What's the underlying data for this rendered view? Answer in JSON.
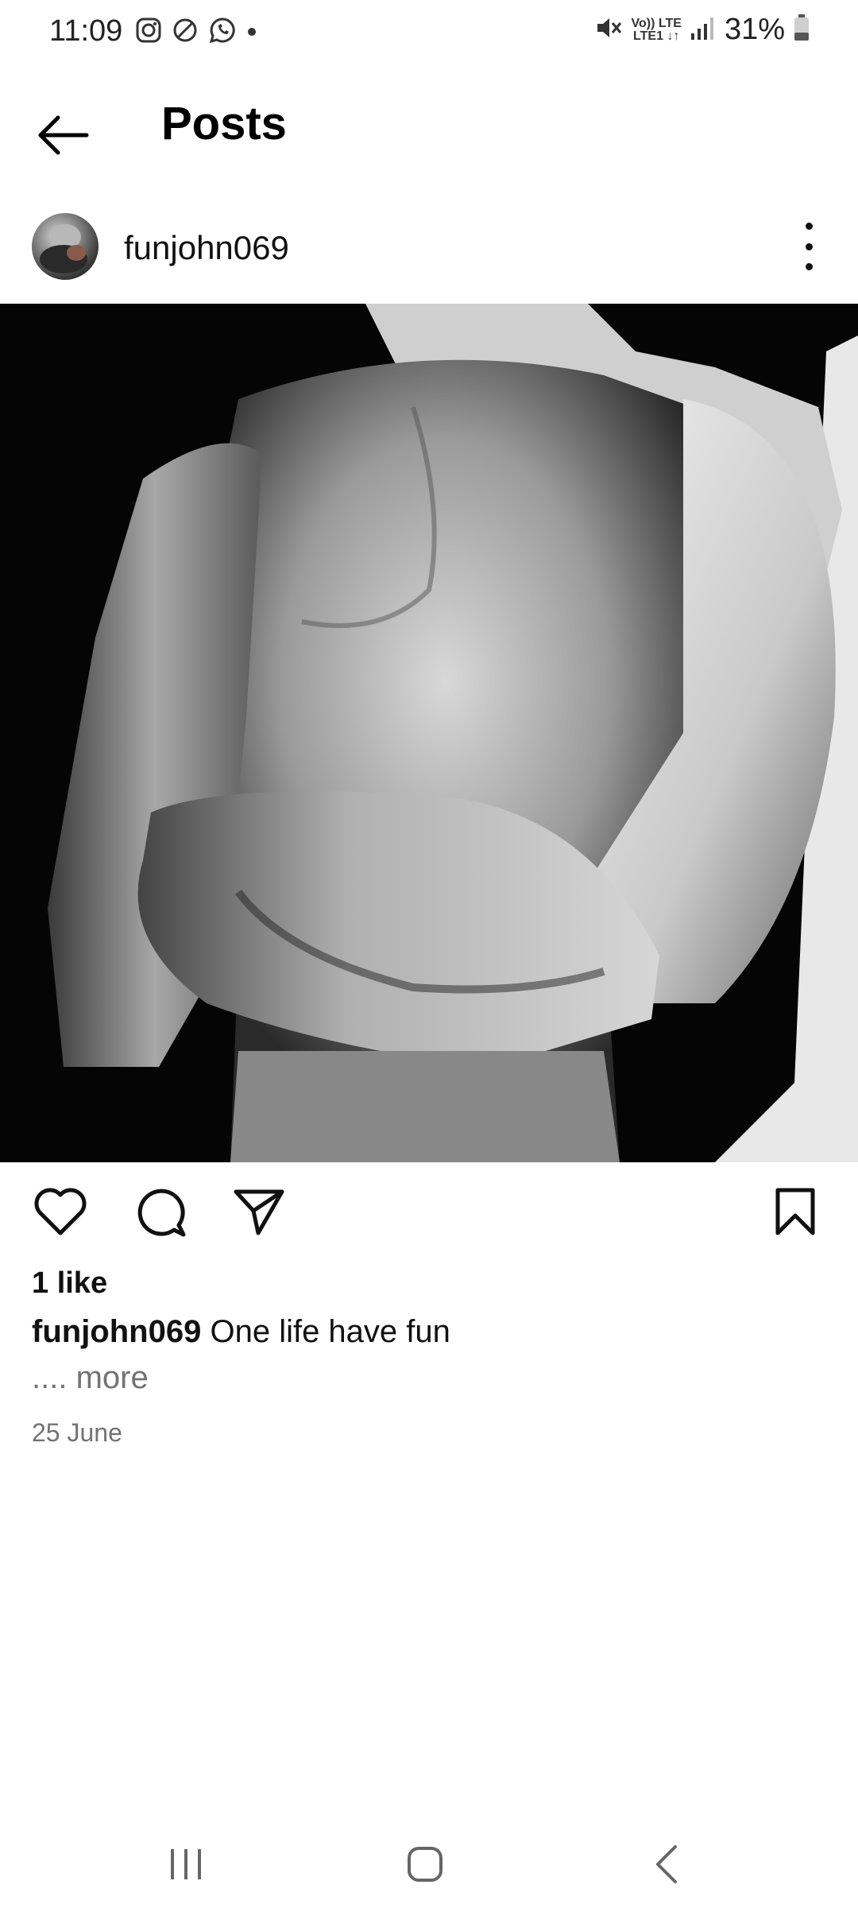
{
  "status_bar": {
    "time": "11:09",
    "left_icons": [
      "instagram-icon",
      "do-not-disturb-icon",
      "whatsapp-icon",
      "dot-icon"
    ],
    "network_top": "Vo)) LTE",
    "network_bottom": "LTE1 ↓↑",
    "battery": "31%"
  },
  "header": {
    "title": "Posts"
  },
  "post": {
    "username": "funjohn069",
    "likes": "1 like",
    "caption_user": "funjohn069",
    "caption_text": "One life have fun",
    "more": ".... more",
    "date": "25 June"
  },
  "colors": {
    "text": "#111111",
    "secondary_text": "#737373",
    "background": "#ffffff"
  }
}
